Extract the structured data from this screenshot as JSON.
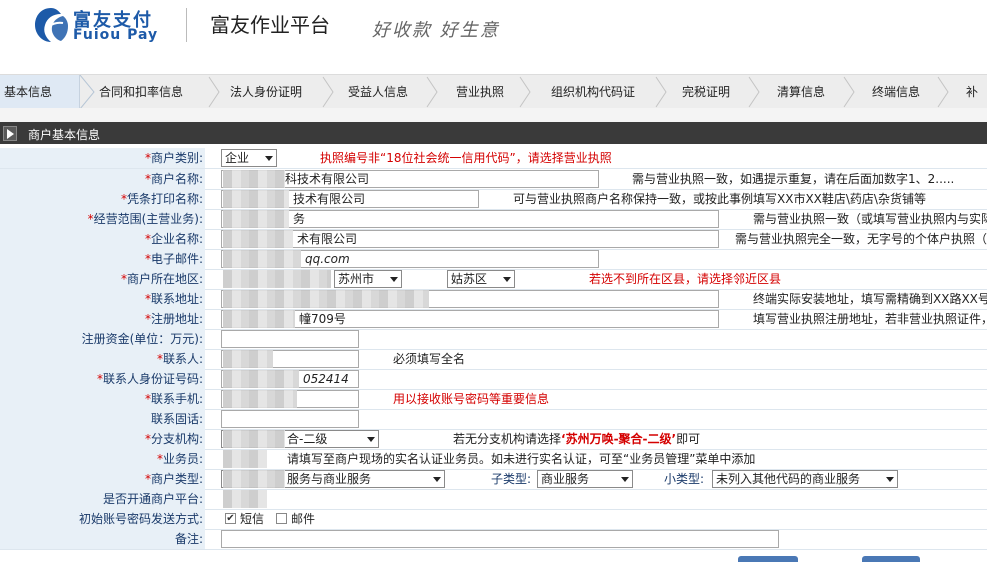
{
  "header": {
    "logo_cn": "富友支付",
    "logo_en": "Fuiou Pay",
    "platform_title": "富友作业平台",
    "slogan": "好收款 好生意"
  },
  "tabs": [
    {
      "label": "基本信息",
      "active": true
    },
    {
      "label": "合同和扣率信息"
    },
    {
      "label": "法人身份证明"
    },
    {
      "label": "受益人信息"
    },
    {
      "label": "营业执照"
    },
    {
      "label": "组织机构代码证"
    },
    {
      "label": "完税证明"
    },
    {
      "label": "清算信息"
    },
    {
      "label": "终端信息"
    },
    {
      "label": "补充"
    }
  ],
  "section": {
    "title": "商户基本信息"
  },
  "colors": {
    "accent": "#1d5aa8",
    "required": "#d40000",
    "label_bg": "#e8f0f7",
    "section_bar": "#3a3a3a"
  },
  "form": {
    "merchant_type": {
      "label": "商户类别:",
      "value": "企业",
      "note": "执照编号非“18位社会统一信用代码”，请选择营业执照"
    },
    "merchant_name": {
      "label": "商户名称:",
      "value": "科技术有限公司",
      "note": "需与营业执照一致，如遇提示重复，请在后面加数字1、2....."
    },
    "receipt_name": {
      "label": "凭条打印名称:",
      "value": "技术有限公司",
      "note": "可与营业执照商户名称保持一致，或按此事例填写XX市XX鞋店\\药店\\杂货铺等"
    },
    "business_scope": {
      "label": "经营范围(主营业务):",
      "value": "务",
      "note": "需与营业执照一致（或填写营业执照内与实际"
    },
    "company_name": {
      "label": "企业名称:",
      "value": "术有限公司",
      "note": "需与营业执照完全一致，无字号的个体户执照（"
    },
    "email": {
      "label": "电子邮件:",
      "value": "qq.com"
    },
    "region": {
      "label": "商户所在地区:",
      "city": "苏州市",
      "district": "姑苏区",
      "note": "若选不到所在区县，请选择邻近区县"
    },
    "contact_address": {
      "label": "联系地址:",
      "value": "",
      "note": "终端实际安装地址，填写需精确到XX路XX号，"
    },
    "registered_address": {
      "label": "注册地址:",
      "value": "幢709号",
      "note": "填写营业执照注册地址，若非营业执照证件，"
    },
    "registered_capital": {
      "label": "注册资金(单位：万元):",
      "value": ""
    },
    "contact_person": {
      "label": "联系人:",
      "value": "",
      "note": "必须填写全名"
    },
    "contact_id": {
      "label": "联系人身份证号码:",
      "value": "052414"
    },
    "contact_mobile": {
      "label": "联系手机:",
      "value": "",
      "note": "用以接收账号密码等重要信息"
    },
    "contact_phone": {
      "label": "联系固话:",
      "value": ""
    },
    "branch": {
      "label": "分支机构:",
      "value": "合-二级",
      "note_pre": "若无分支机构请选择",
      "note_hl": "‘苏州万唤-聚合-二级’",
      "note_post": "即可"
    },
    "salesman": {
      "label": "业务员:",
      "note": "请填写至商户现场的实名认证业务员。如未进行实名认证，可至“业务员管理”菜单中添加"
    },
    "merchant_category": {
      "label": "商户类型:",
      "value": "服务与商业服务",
      "subtype_label": "子类型:",
      "subtype_value": "商业服务",
      "minor_label": "小类型:",
      "minor_value": "未列入其他代码的商业服务"
    },
    "open_platform": {
      "label": "是否开通商户平台:"
    },
    "init_send": {
      "label": "初始账号密码发送方式:",
      "opt_sms": "短信",
      "opt_sms_checked": true,
      "opt_mail": "邮件",
      "opt_mail_checked": false
    },
    "remark": {
      "label": "备注:",
      "value": ""
    }
  }
}
